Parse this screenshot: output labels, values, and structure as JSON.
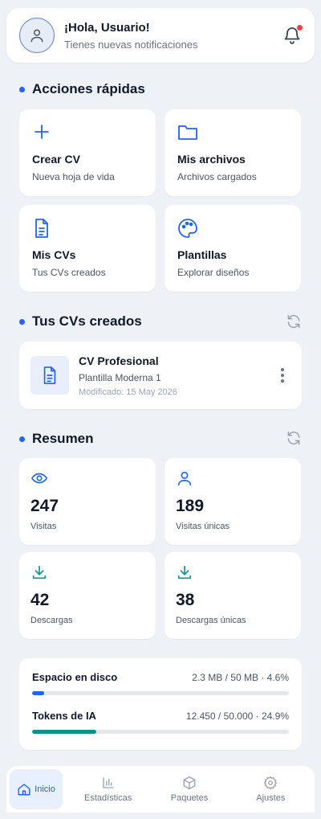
{
  "header": {
    "greeting": "¡Hola, Usuario!",
    "subtitle": "Tienes nuevas notificaciones"
  },
  "quick_actions": {
    "title": "Acciones rápidas",
    "items": [
      {
        "title": "Crear CV",
        "desc": "Nueva hoja de vida",
        "icon": "plus-icon"
      },
      {
        "title": "Mis archivos",
        "desc": "Archivos cargados",
        "icon": "folder-icon"
      },
      {
        "title": "Mis CVs",
        "desc": "Tus CVs creados",
        "icon": "document-icon"
      },
      {
        "title": "Plantillas",
        "desc": "Explorar diseños",
        "icon": "palette-icon"
      }
    ]
  },
  "cvs": {
    "title": "Tus CVs creados",
    "items": [
      {
        "name": "CV Profesional",
        "template": "Plantilla Moderna 1",
        "modified": "Modificado: 15 May 2026"
      }
    ]
  },
  "summary": {
    "title": "Resumen",
    "stats": [
      {
        "value": "247",
        "label": "Visitas",
        "icon": "eye-icon"
      },
      {
        "value": "189",
        "label": "Visitas únicas",
        "icon": "user-icon"
      },
      {
        "value": "42",
        "label": "Descargas",
        "icon": "download-icon"
      },
      {
        "value": "38",
        "label": "Descargas únicas",
        "icon": "download-icon"
      }
    ],
    "usage": [
      {
        "label": "Espacio en disco",
        "value": "2.3 MB / 50 MB · 4.6%",
        "percent": 4.6,
        "color": "#2563eb"
      },
      {
        "label": "Tokens de IA",
        "value": "12.450 / 50.000 · 24.9%",
        "percent": 24.9,
        "color": "#0d9488"
      }
    ]
  },
  "nav": {
    "items": [
      {
        "label": "Inicio",
        "icon": "home-icon"
      },
      {
        "label": "Estadísticas",
        "icon": "bar-chart-icon"
      },
      {
        "label": "Paquetes",
        "icon": "package-icon"
      },
      {
        "label": "Ajustes",
        "icon": "gear-icon"
      }
    ]
  },
  "colors": {
    "accent": "#2563eb",
    "teal": "#0d9488",
    "background": "#eef2f7",
    "notification": "#ef4444"
  }
}
